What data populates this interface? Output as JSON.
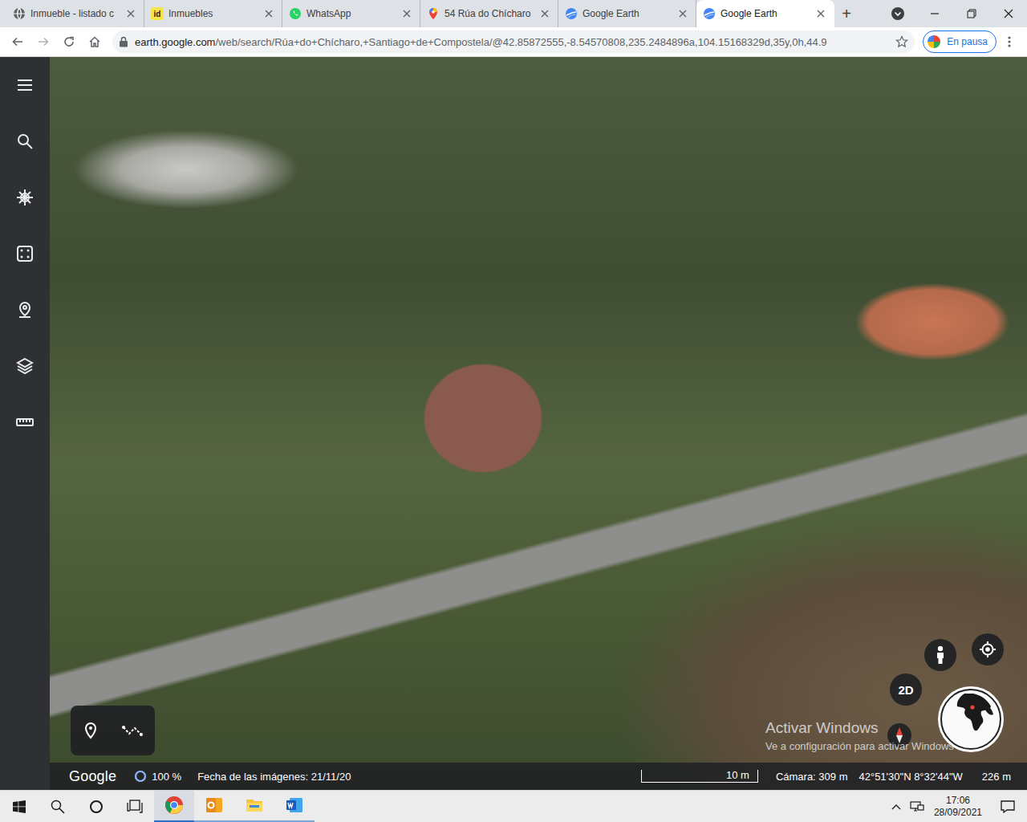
{
  "browser": {
    "tabs": [
      {
        "label": "Inmueble - listado c",
        "selected": false,
        "kind": "generic"
      },
      {
        "label": "Inmuebles",
        "selected": false,
        "kind": "id",
        "favicon_text": "id"
      },
      {
        "label": "WhatsApp",
        "selected": false,
        "kind": "whatsapp"
      },
      {
        "label": "54 Rúa do Chícharo",
        "selected": false,
        "kind": "maps"
      },
      {
        "label": "Google Earth",
        "selected": false,
        "kind": "earth"
      },
      {
        "label": "Google Earth",
        "selected": true,
        "kind": "earth"
      }
    ],
    "new_tab": "+",
    "url_host": "earth.google.com",
    "url_path": "/web/search/Rúa+do+Chícharo,+Santiago+de+Compostela/@42.85872555,-8.54570808,235.2484896a,104.15168329d,35y,0h,44.9",
    "profile": "En pausa"
  },
  "earth": {
    "logo": "Google",
    "loading_level": 1,
    "loading": "100 %",
    "imagery_date": "Fecha de las imágenes: 21/11/20",
    "scale": "10 m",
    "camera": "Cámara: 309 m",
    "coordinates": "42°51'30\"N 8°32'44\"W",
    "elevation": "226 m",
    "view_mode": "2D"
  },
  "watermark": {
    "title": "Activar Windows",
    "subtitle": "Ve a configuración para activar Windows"
  },
  "taskbar": {
    "apps": [
      {
        "kind": "chrome",
        "open": true,
        "active": true
      },
      {
        "kind": "outlook",
        "open": true,
        "active": false
      },
      {
        "kind": "explorer",
        "open": true,
        "active": false
      },
      {
        "kind": "word",
        "open": true,
        "active": false
      }
    ],
    "time": "17:06",
    "date": "28/09/2021"
  }
}
